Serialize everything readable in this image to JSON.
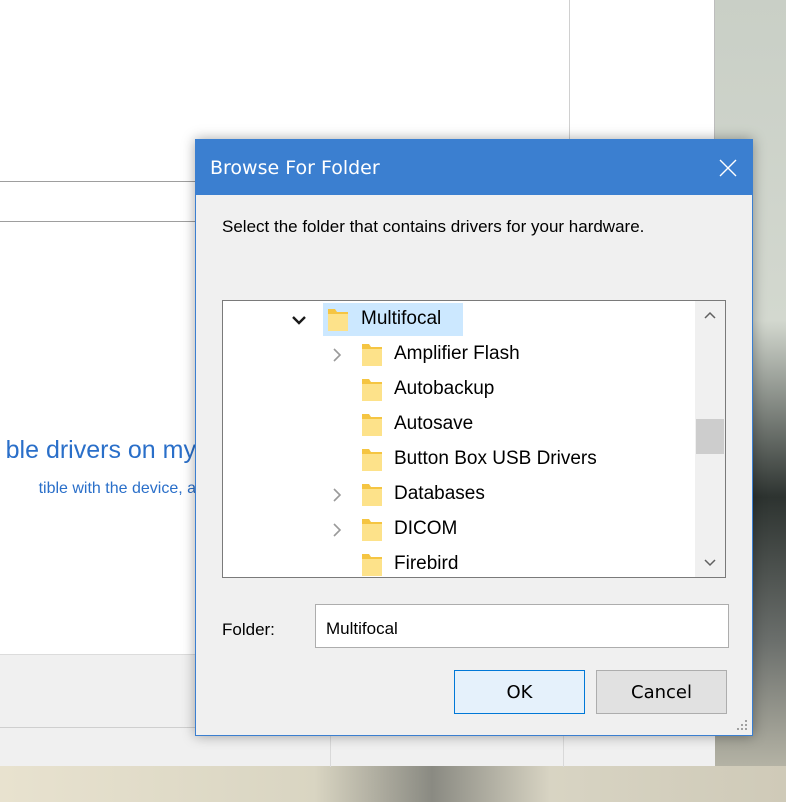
{
  "background_window": {
    "link_text": "ble drivers on my",
    "description_text": "tible with the device, a"
  },
  "dialog": {
    "title": "Browse For Folder",
    "instructions": "Select the folder that contains drivers for your hardware.",
    "tree_items": [
      {
        "label": "Multifocal",
        "expander": "chevron-down-icon",
        "selected": true
      },
      {
        "label": "Amplifier Flash",
        "expander": "chevron-right-icon",
        "selected": false
      },
      {
        "label": "Autobackup",
        "expander": "",
        "selected": false
      },
      {
        "label": "Autosave",
        "expander": "",
        "selected": false
      },
      {
        "label": "Button Box USB Drivers",
        "expander": "",
        "selected": false
      },
      {
        "label": "Databases",
        "expander": "chevron-right-icon",
        "selected": false
      },
      {
        "label": "DICOM",
        "expander": "chevron-right-icon",
        "selected": false
      },
      {
        "label": "Firebird",
        "expander": "",
        "selected": false
      }
    ],
    "folder_label": "Folder:",
    "folder_value": "Multifocal",
    "ok_label": "OK",
    "cancel_label": "Cancel"
  },
  "colors": {
    "title_bar": "#3b7fd0",
    "selection": "#cce8ff",
    "folder_icon": "#f5c542",
    "link": "#2a6fc9"
  }
}
